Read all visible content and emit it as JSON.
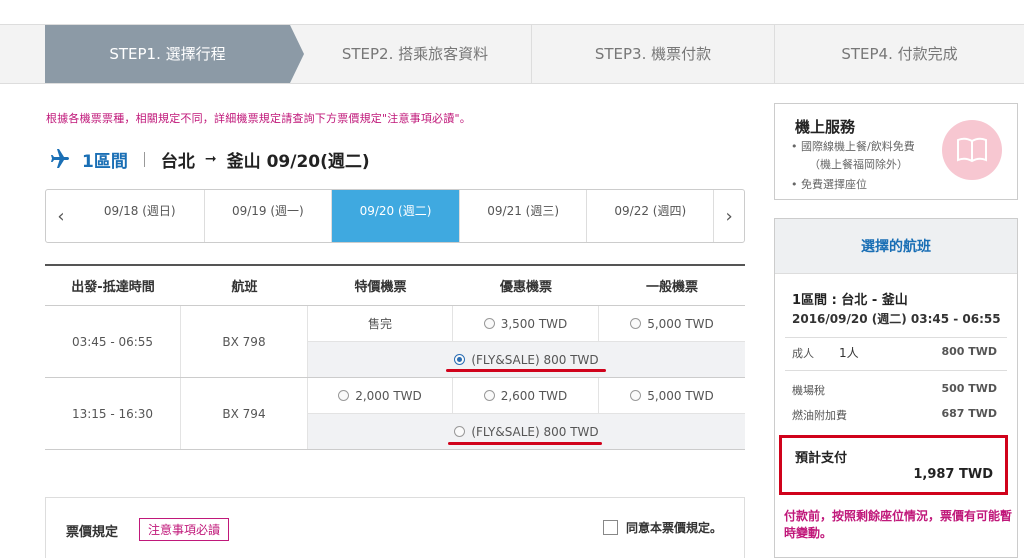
{
  "steps": [
    "STEP1. 選擇行程",
    "STEP2. 搭乘旅客資料",
    "STEP3. 機票付款",
    "STEP4. 付款完成"
  ],
  "notice": "根據各機票票種，相關規定不同，詳細機票規定請查詢下方票價規定\"注意事項必讀\"。",
  "route": {
    "section": "1區間",
    "from": "台北",
    "to": "釜山",
    "date": "09/20(週二)"
  },
  "dates": {
    "tabs": [
      "09/18 (週日)",
      "09/19 (週一)",
      "09/20 (週二)",
      "09/21 (週三)",
      "09/22 (週四)"
    ],
    "selected_index": 2,
    "prev": "‹",
    "next": "›"
  },
  "table": {
    "headers": [
      "出發-抵達時間",
      "航班",
      "特價機票",
      "優惠機票",
      "一般機票"
    ],
    "rows": [
      {
        "time": "03:45 - 06:55",
        "flight": "BX 798",
        "special": "售完",
        "discount": "3,500 TWD",
        "normal": "5,000 TWD",
        "promo": "(FLY&SALE) 800 TWD",
        "promo_selected": true
      },
      {
        "time": "13:15 - 16:30",
        "flight": "BX 794",
        "special": "2,000 TWD",
        "discount": "2,600 TWD",
        "normal": "5,000 TWD",
        "promo": "(FLY&SALE) 800 TWD",
        "promo_selected": false
      }
    ]
  },
  "rules": {
    "label": "票價規定",
    "must_read": "注意事項必讀",
    "agree": "同意本票價規定。",
    "agree_checked": false
  },
  "service": {
    "title": "機上服務",
    "lines": [
      "• 國際線機上餐/飲料免費",
      "（機上餐福岡除外）",
      "• 免費選擇座位"
    ],
    "icon": "book-icon"
  },
  "selected": {
    "title": "選擇的航班",
    "section": "1區間 : 台北 - 釜山",
    "datetime": "2016/09/20 (週二) 03:45 - 06:55",
    "adult_label": "成人",
    "adult_count": "1人",
    "adult_price": "800 TWD",
    "airport_tax_label": "機場稅",
    "airport_tax": "500 TWD",
    "fuel_label": "燃油附加費",
    "fuel": "687 TWD",
    "total_label": "預計支付",
    "total": "1,987 TWD",
    "warning": "付款前，按照剩餘座位情況，票價有可能暫時變動。"
  },
  "colors": {
    "accent": "#3fa9e0",
    "brand_blue": "#1a6fb5",
    "highlight_red": "#d0021b",
    "notice_pink": "#c0187a",
    "step_active": "#8c9aa6"
  }
}
